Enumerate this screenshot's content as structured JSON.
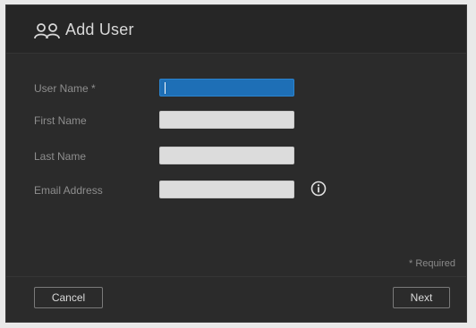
{
  "dialog": {
    "title": "Add User",
    "icon": "users-icon"
  },
  "form": {
    "fields": [
      {
        "label": "User Name *",
        "value": "",
        "placeholder": "",
        "state": "focused"
      },
      {
        "label": "First Name",
        "value": "",
        "placeholder": ""
      },
      {
        "label": "Last Name",
        "value": "",
        "placeholder": ""
      },
      {
        "label": "Email Address",
        "value": "",
        "placeholder": ""
      }
    ],
    "info_icon": "info-icon",
    "required_note": "* Required"
  },
  "footer": {
    "cancel_label": "Cancel",
    "next_label": "Next"
  },
  "colors": {
    "dialog_bg": "#2b2b2b",
    "focused_input": "#1e6fb6",
    "input_bg": "#dcdcdc"
  }
}
